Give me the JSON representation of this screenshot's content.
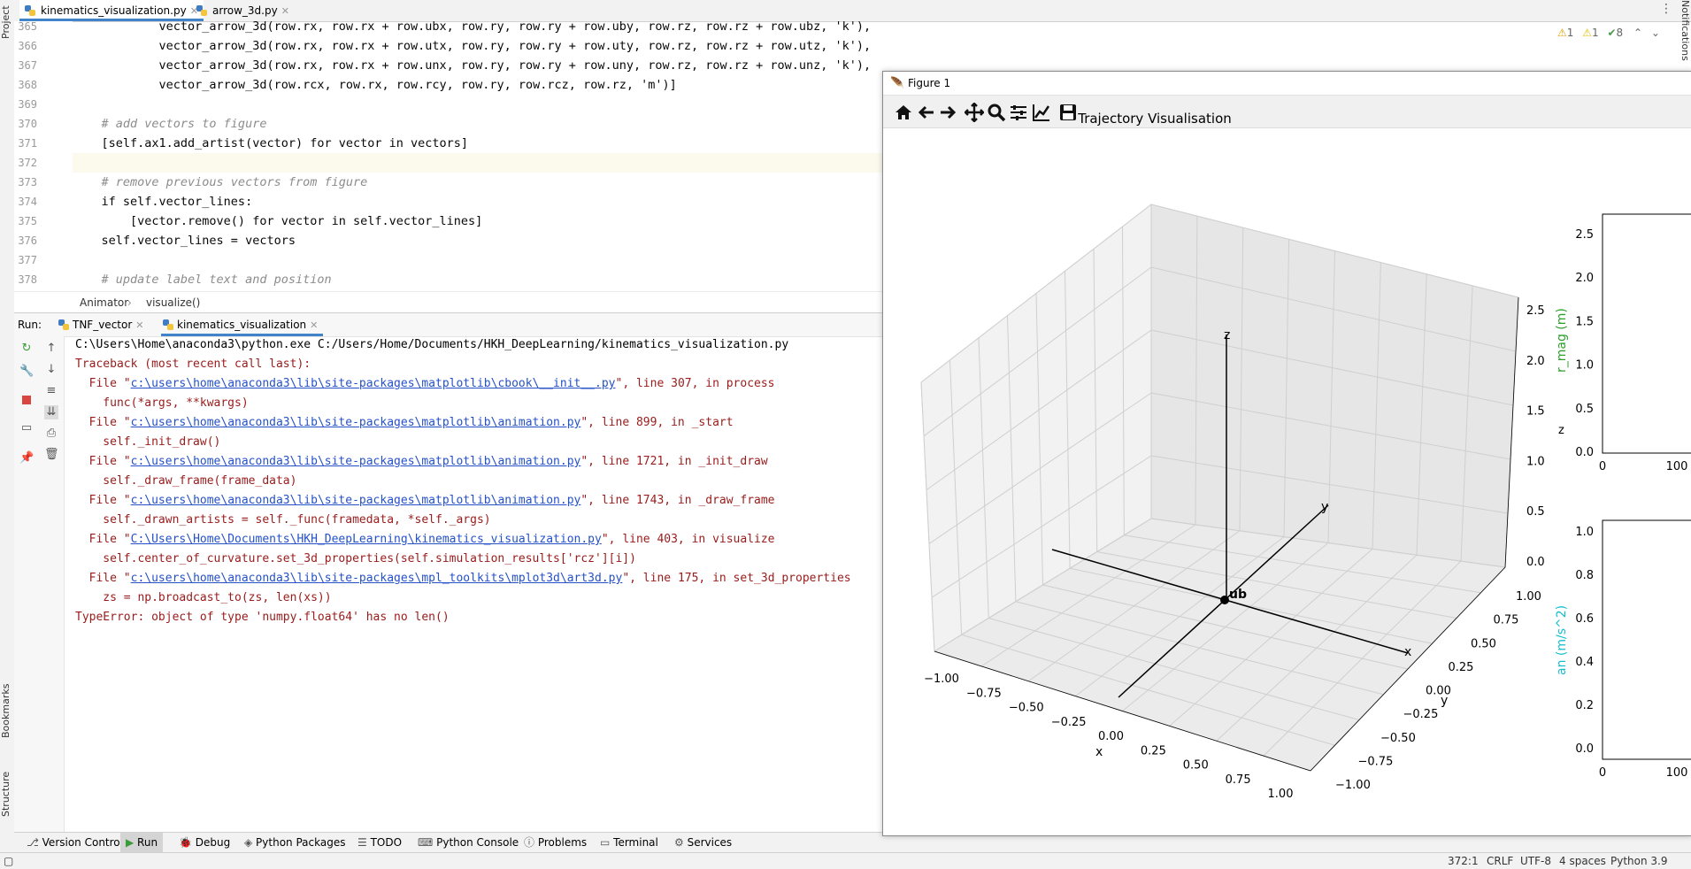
{
  "left_strip": {
    "project": "Project",
    "bookmarks": "Bookmarks",
    "structure": "Structure"
  },
  "tabs": [
    {
      "label": "kinematics_visualization.py",
      "active": true
    },
    {
      "label": "arrow_3d.py",
      "active": false
    }
  ],
  "tabbar_right": {
    "more": "⋮",
    "notifications": "Notifications"
  },
  "inspections": {
    "warn1": "1",
    "warn2": "1",
    "ok": "8"
  },
  "editor": {
    "lines": [
      {
        "n": "365",
        "text": "            vector_arrow_3d(row.rx, row.rx + row.ubx, row.ry, row.ry + row.uby, row.rz, row.rz + row.ubz, 'k'),"
      },
      {
        "n": "366",
        "text": "            vector_arrow_3d(row.rx, row.rx + row.utx, row.ry, row.ry + row.uty, row.rz, row.rz + row.utz, 'k'),"
      },
      {
        "n": "367",
        "text": "            vector_arrow_3d(row.rx, row.rx + row.unx, row.ry, row.ry + row.uny, row.rz, row.rz + row.unz, 'k'),"
      },
      {
        "n": "368",
        "text": "            vector_arrow_3d(row.rcx, row.rx, row.rcy, row.ry, row.rcz, row.rz, 'm')]"
      },
      {
        "n": "369",
        "text": ""
      },
      {
        "n": "370",
        "text": "    # add vectors to figure"
      },
      {
        "n": "371",
        "text": "    [self.ax1.add_artist(vector) for vector in vectors]"
      },
      {
        "n": "372",
        "text": ""
      },
      {
        "n": "373",
        "text": "    # remove previous vectors from figure"
      },
      {
        "n": "374",
        "text": "    if self.vector_lines:"
      },
      {
        "n": "375",
        "text": "        [vector.remove() for vector in self.vector_lines]"
      },
      {
        "n": "376",
        "text": "    self.vector_lines = vectors"
      },
      {
        "n": "377",
        "text": ""
      },
      {
        "n": "378",
        "text": "    # update label text and position"
      }
    ]
  },
  "breadcrumb": {
    "cls": "Animator",
    "method": "visualize()"
  },
  "run": {
    "label": "Run:",
    "tabs": [
      "TNF_vector",
      "kinematics_visualization"
    ],
    "output": [
      {
        "type": "plain",
        "text": "C:\\Users\\Home\\anaconda3\\python.exe C:/Users/Home/Documents/HKH_DeepLearning/kinematics_visualization.py"
      },
      {
        "type": "err",
        "text": "Traceback (most recent call last):"
      },
      {
        "type": "file",
        "pre": "  File \"",
        "link": "c:\\users\\home\\anaconda3\\lib\\site-packages\\matplotlib\\cbook\\__init__.py",
        "post": "\", line 307, in process"
      },
      {
        "type": "err",
        "text": "    func(*args, **kwargs)"
      },
      {
        "type": "file",
        "pre": "  File \"",
        "link": "c:\\users\\home\\anaconda3\\lib\\site-packages\\matplotlib\\animation.py",
        "post": "\", line 899, in _start"
      },
      {
        "type": "err",
        "text": "    self._init_draw()"
      },
      {
        "type": "file",
        "pre": "  File \"",
        "link": "c:\\users\\home\\anaconda3\\lib\\site-packages\\matplotlib\\animation.py",
        "post": "\", line 1721, in _init_draw"
      },
      {
        "type": "err",
        "text": "    self._draw_frame(frame_data)"
      },
      {
        "type": "file",
        "pre": "  File \"",
        "link": "c:\\users\\home\\anaconda3\\lib\\site-packages\\matplotlib\\animation.py",
        "post": "\", line 1743, in _draw_frame"
      },
      {
        "type": "err",
        "text": "    self._drawn_artists = self._func(framedata, *self._args)"
      },
      {
        "type": "file",
        "pre": "  File \"",
        "link": "C:\\Users\\Home\\Documents\\HKH_DeepLearning\\kinematics_visualization.py",
        "post": "\", line 403, in visualize"
      },
      {
        "type": "err",
        "text": "    self.center_of_curvature.set_3d_properties(self.simulation_results['rcz'][i])"
      },
      {
        "type": "file",
        "pre": "  File \"",
        "link": "c:\\users\\home\\anaconda3\\lib\\site-packages\\mpl_toolkits\\mplot3d\\art3d.py",
        "post": "\", line 175, in set_3d_properties"
      },
      {
        "type": "err",
        "text": "    zs = np.broadcast_to(zs, len(xs))"
      },
      {
        "type": "err",
        "text": "TypeError: object of type 'numpy.float64' has no len()"
      }
    ]
  },
  "toolwindows": [
    "Version Control",
    "Run",
    "Debug",
    "Python Packages",
    "TODO",
    "Python Console",
    "Problems",
    "Terminal",
    "Services"
  ],
  "status": {
    "pos": "372:1",
    "eol": "CRLF",
    "enc": "UTF-8",
    "indent": "4 spaces",
    "interp": "Python 3.9"
  },
  "figure": {
    "title": "Figure 1",
    "plot_title": "Trajectory Visualisation",
    "accent": "#4083c9",
    "toolbar_icons": [
      "home-icon",
      "back-icon",
      "forward-icon",
      "pan-icon",
      "zoom-icon",
      "configure-icon",
      "edit-curve-icon",
      "save-icon"
    ],
    "axes3d": {
      "x_ticks": [
        "−1.00",
        "−0.75",
        "−0.50",
        "−0.25",
        "0.00",
        "0.25",
        "0.50",
        "0.75",
        "1.00"
      ],
      "y_ticks": [
        "1.00",
        "0.75",
        "0.50",
        "0.25",
        "0.00",
        "−0.25",
        "−0.50",
        "−0.75",
        "−1.00"
      ],
      "z_ticks": [
        "2.5",
        "2.0",
        "1.5",
        "1.0",
        "0.5",
        "0.0"
      ],
      "xlabel": "x",
      "ylabel": "y",
      "zlabel": "z",
      "axis_labels": {
        "z": "z",
        "y": "y",
        "x": "x"
      },
      "point_label": "ub"
    },
    "subplot_top": {
      "ylabel": "r_mag (m)",
      "ylabel_color": "#2ca02c",
      "z_label": "z",
      "y_ticks": [
        "2.5",
        "2.0",
        "1.5",
        "1.0",
        "0.5",
        "0.0"
      ],
      "x_ticks": [
        "0",
        "100"
      ]
    },
    "subplot_bottom": {
      "ylabel": "an (m/s^2)",
      "ylabel_color": "#17becf",
      "y_ticks": [
        "1.0",
        "0.8",
        "0.6",
        "0.4",
        "0.2",
        "0.0"
      ],
      "x_ticks": [
        "0",
        "100"
      ]
    }
  }
}
